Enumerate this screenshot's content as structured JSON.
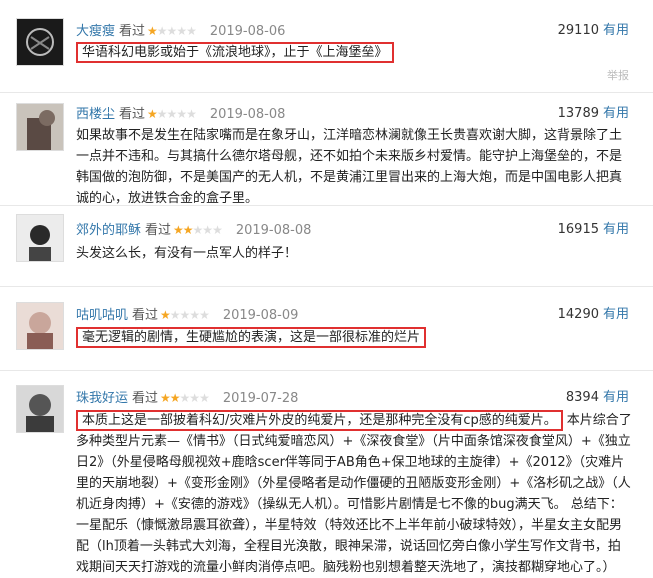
{
  "reviews": [
    {
      "user": "大瘦瘦",
      "status": "看过",
      "date": "2019-08-06",
      "votes": "29110",
      "useful": "有用",
      "text": "华语科幻电影或始于《流浪地球》，止于《上海堡垒》",
      "report": "举报",
      "rating": 1
    },
    {
      "user": "西楼尘",
      "status": "看过",
      "date": "2019-08-08",
      "votes": "13789",
      "useful": "有用",
      "text": "如果故事不是发生在陆家嘴而是在象牙山，江洋暗恋林澜就像王长贵喜欢谢大脚，这背景除了土一点并不违和。与其搞什么德尔塔母舰，还不如拍个未来版乡村爱情。能守护上海堡垒的，不是韩国做的泡防御，不是美国产的无人机，不是黄浦江里冒出来的上海大炮，而是中国电影人把真诚的心，放进铁合金的盒子里。",
      "rating": 1
    },
    {
      "user": "郊外的耶稣",
      "status": "看过",
      "date": "2019-08-08",
      "votes": "16915",
      "useful": "有用",
      "text": "头发这么长，有没有一点军人的样子！",
      "rating": 2
    },
    {
      "user": "咕叽咕叽",
      "status": "看过",
      "date": "2019-08-09",
      "votes": "14290",
      "useful": "有用",
      "text": "毫无逻辑的剧情，生硬尴尬的表演，这是一部很标准的烂片",
      "rating": 1
    },
    {
      "user": "珠我好运",
      "status": "看过",
      "date": "2019-07-28",
      "votes": "8394",
      "useful": "有用",
      "text_highlight": "本质上这是一部披着科幻/灾难片外皮的纯爱片，还是那种完全没有cp感的纯爱片。",
      "text_line1_rest": "本片综合了多种类型片",
      "text_rest": "元素—《情书》（日式纯爱暗恋风）+《深夜食堂》（片中面条馆深夜食堂风）+《独立日2》（外星侵略母舰视效+鹿晗scer伴等同于AB角色+保卫地球的主旋律）+《2012》（灾难片里的天崩地裂）+《变形金刚》（外星侵略者是动作僵硬的丑陋版变形金刚）+《洛杉矶之战》（人机近身肉搏）+《安德的游戏》（操纵无人机）。可惜影片剧情是七不像的bug满天飞。 总结下：一星配乐（慷慨激昂震耳欲聋），半星特效（特效还比不上半年前小破球特效），半星女主女配男配（lh顶着一头韩式大刘海，全程目光涣散，眼神呆滞，说话回忆旁白像小学生写作文背书，拍戏期间天天打游戏的流量小鲜肉消停点吧。脑残粉也别想着整天洗地了，演技都糊穿地心了。）",
      "rating": 2
    }
  ]
}
